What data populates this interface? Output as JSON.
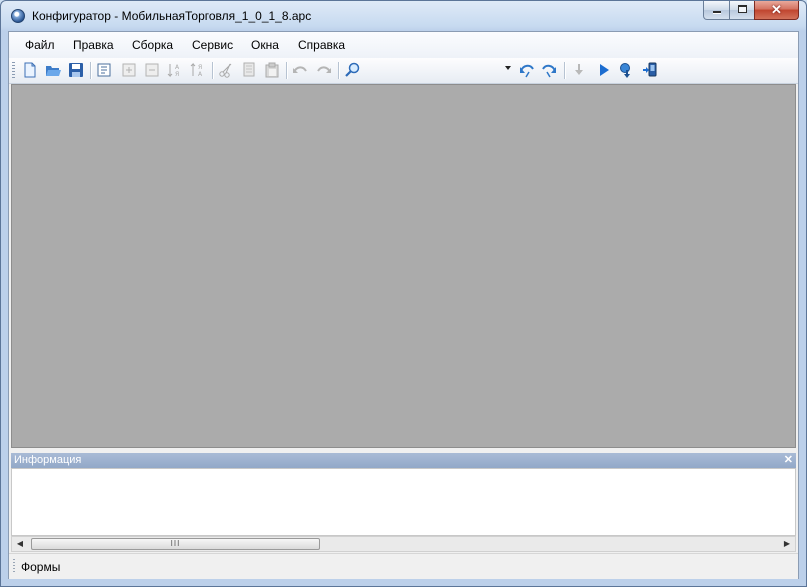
{
  "window": {
    "title": "Конфигуратор - МобильнаяТорговля_1_0_1_8.apc",
    "close_glyph": "✕"
  },
  "menu": {
    "items": [
      "Файл",
      "Правка",
      "Сборка",
      "Сервис",
      "Окна",
      "Справка"
    ]
  },
  "toolbar": {
    "buttons": [
      {
        "icon": "new-document-icon",
        "enabled": true
      },
      {
        "icon": "open-folder-icon",
        "enabled": true
      },
      {
        "icon": "save-icon",
        "enabled": true
      },
      {
        "icon": "properties-icon",
        "enabled": true
      },
      {
        "icon": "expand-icon",
        "enabled": false
      },
      {
        "icon": "collapse-icon",
        "enabled": false
      },
      {
        "icon": "sort-ascending-icon",
        "enabled": false
      },
      {
        "icon": "sort-descending-icon",
        "enabled": false
      },
      {
        "icon": "cut-icon",
        "enabled": false
      },
      {
        "icon": "copy-icon",
        "enabled": false
      },
      {
        "icon": "paste-icon",
        "enabled": false
      },
      {
        "icon": "undo-icon",
        "enabled": false
      },
      {
        "icon": "redo-icon",
        "enabled": false
      },
      {
        "icon": "find-icon",
        "enabled": true
      },
      {
        "icon": "combo-dropdown-icon",
        "enabled": true
      },
      {
        "icon": "find-previous-icon",
        "enabled": true
      },
      {
        "icon": "find-next-icon",
        "enabled": true
      },
      {
        "icon": "download-icon",
        "enabled": false
      },
      {
        "icon": "run-icon",
        "enabled": true
      },
      {
        "icon": "debug-icon",
        "enabled": true
      },
      {
        "icon": "deploy-device-icon",
        "enabled": true
      }
    ]
  },
  "panels": {
    "info": {
      "title": "Информация",
      "close_glyph": "✕"
    },
    "scrollbar": {
      "left_arrow": "◀",
      "right_arrow": "▶",
      "grip": "III"
    }
  },
  "status": {
    "text": "Формы"
  },
  "colors": {
    "workspace": "#ababab",
    "info_header": "#9fb2d0",
    "accent": "#2a6fc9"
  }
}
